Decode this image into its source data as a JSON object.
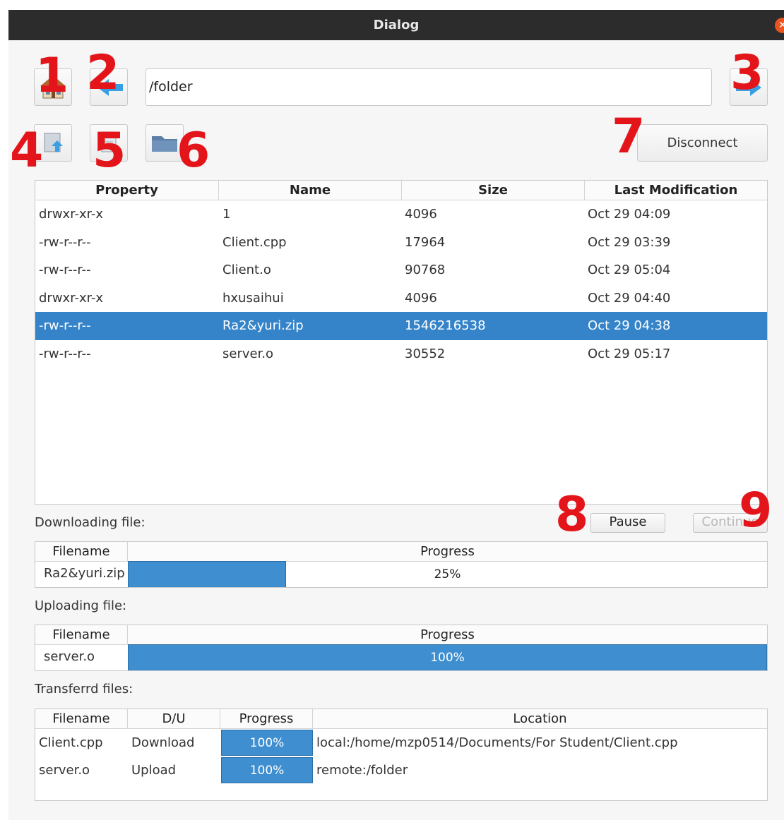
{
  "window": {
    "title": "Dialog",
    "close_glyph": "✕"
  },
  "toolbar": {
    "path_value": "/folder",
    "icons": [
      "home-icon",
      "back-arrow-icon",
      "forward-arrow-icon",
      "upload-icon",
      "document-icon",
      "folder-icon"
    ],
    "disconnect_label": "Disconnect"
  },
  "markers": [
    "1",
    "2",
    "3",
    "4",
    "5",
    "6",
    "7",
    "8",
    "9"
  ],
  "file_table": {
    "columns": [
      "Property",
      "Name",
      "Size",
      "Last Modification"
    ],
    "rows": [
      {
        "property": "drwxr-xr-x",
        "name": "1",
        "size": "4096",
        "modified": "Oct 29 04:09"
      },
      {
        "property": "-rw-r--r--",
        "name": "Client.cpp",
        "size": "17964",
        "modified": "Oct 29 03:39"
      },
      {
        "property": "-rw-r--r--",
        "name": "Client.o",
        "size": "90768",
        "modified": "Oct 29 05:04"
      },
      {
        "property": "drwxr-xr-x",
        "name": "hxusaihui",
        "size": "4096",
        "modified": "Oct 29 04:40"
      },
      {
        "property": "-rw-r--r--",
        "name": "Ra2&yuri.zip",
        "size": "1546216538",
        "modified": "Oct 29 04:38"
      },
      {
        "property": "-rw-r--r--",
        "name": "server.o",
        "size": "30552",
        "modified": "Oct 29 05:17"
      }
    ],
    "selected_row": 4
  },
  "downloading": {
    "label": "Downloading file:",
    "pause_label": "Pause",
    "continue_label": "Continue",
    "columns": [
      "Filename",
      "Progress"
    ],
    "filename": "Ra2&yuri.zip",
    "progress": 0.25,
    "progress_text": "25%"
  },
  "uploading": {
    "label": "Uploading file:",
    "columns": [
      "Filename",
      "Progress"
    ],
    "filename": "server.o",
    "progress": 1.0,
    "progress_text": "100%"
  },
  "transferred": {
    "label": "Transferrd files:",
    "columns": [
      "Filename",
      "D/U",
      "Progress",
      "Location"
    ],
    "rows": [
      {
        "filename": "Client.cpp",
        "du": "Download",
        "progress": "100%",
        "location": "local:/home/mzp0514/Documents/For Student/Client.cpp"
      },
      {
        "filename": "server.o",
        "du": "Upload",
        "progress": "100%",
        "location": "remote:/folder"
      }
    ]
  },
  "colors": {
    "accent": "#3584c9",
    "titlebar": "#2c2c2c",
    "close": "#e95420",
    "marker": "#e3151a"
  }
}
